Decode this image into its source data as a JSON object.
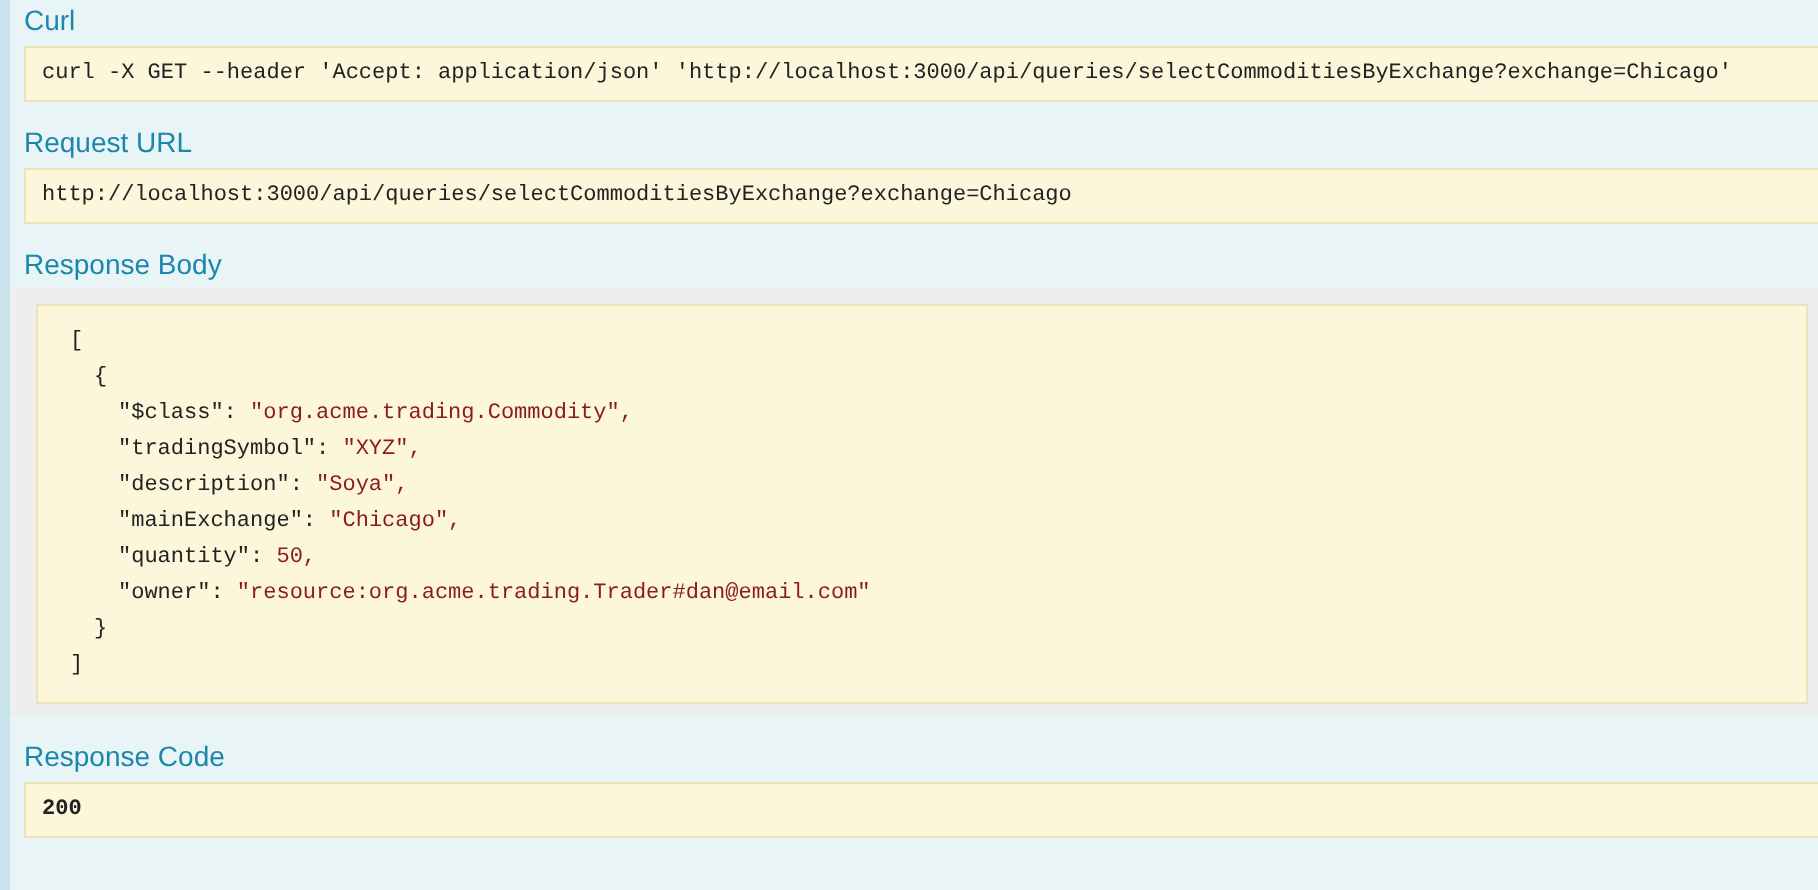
{
  "curl": {
    "heading": "Curl",
    "command": "curl -X GET --header 'Accept: application/json' 'http://localhost:3000/api/queries/selectCommoditiesByExchange?exchange=Chicago'"
  },
  "request_url": {
    "heading": "Request URL",
    "url": "http://localhost:3000/api/queries/selectCommoditiesByExchange?exchange=Chicago"
  },
  "response_body": {
    "heading": "Response Body",
    "open": "[",
    "close": "]",
    "items": [
      {
        "open": "{",
        "close": "}",
        "pairs": [
          {
            "key": "\"$class\":",
            "value": "\"org.acme.trading.Commodity\","
          },
          {
            "key": "\"tradingSymbol\":",
            "value": "\"XYZ\","
          },
          {
            "key": "\"description\":",
            "value": "\"Soya\","
          },
          {
            "key": "\"mainExchange\":",
            "value": "\"Chicago\","
          },
          {
            "key": "\"quantity\":",
            "value": "50,"
          },
          {
            "key": "\"owner\":",
            "value": "\"resource:org.acme.trading.Trader#dan@email.com\""
          }
        ]
      }
    ]
  },
  "response_code": {
    "heading": "Response Code",
    "code": "200"
  }
}
